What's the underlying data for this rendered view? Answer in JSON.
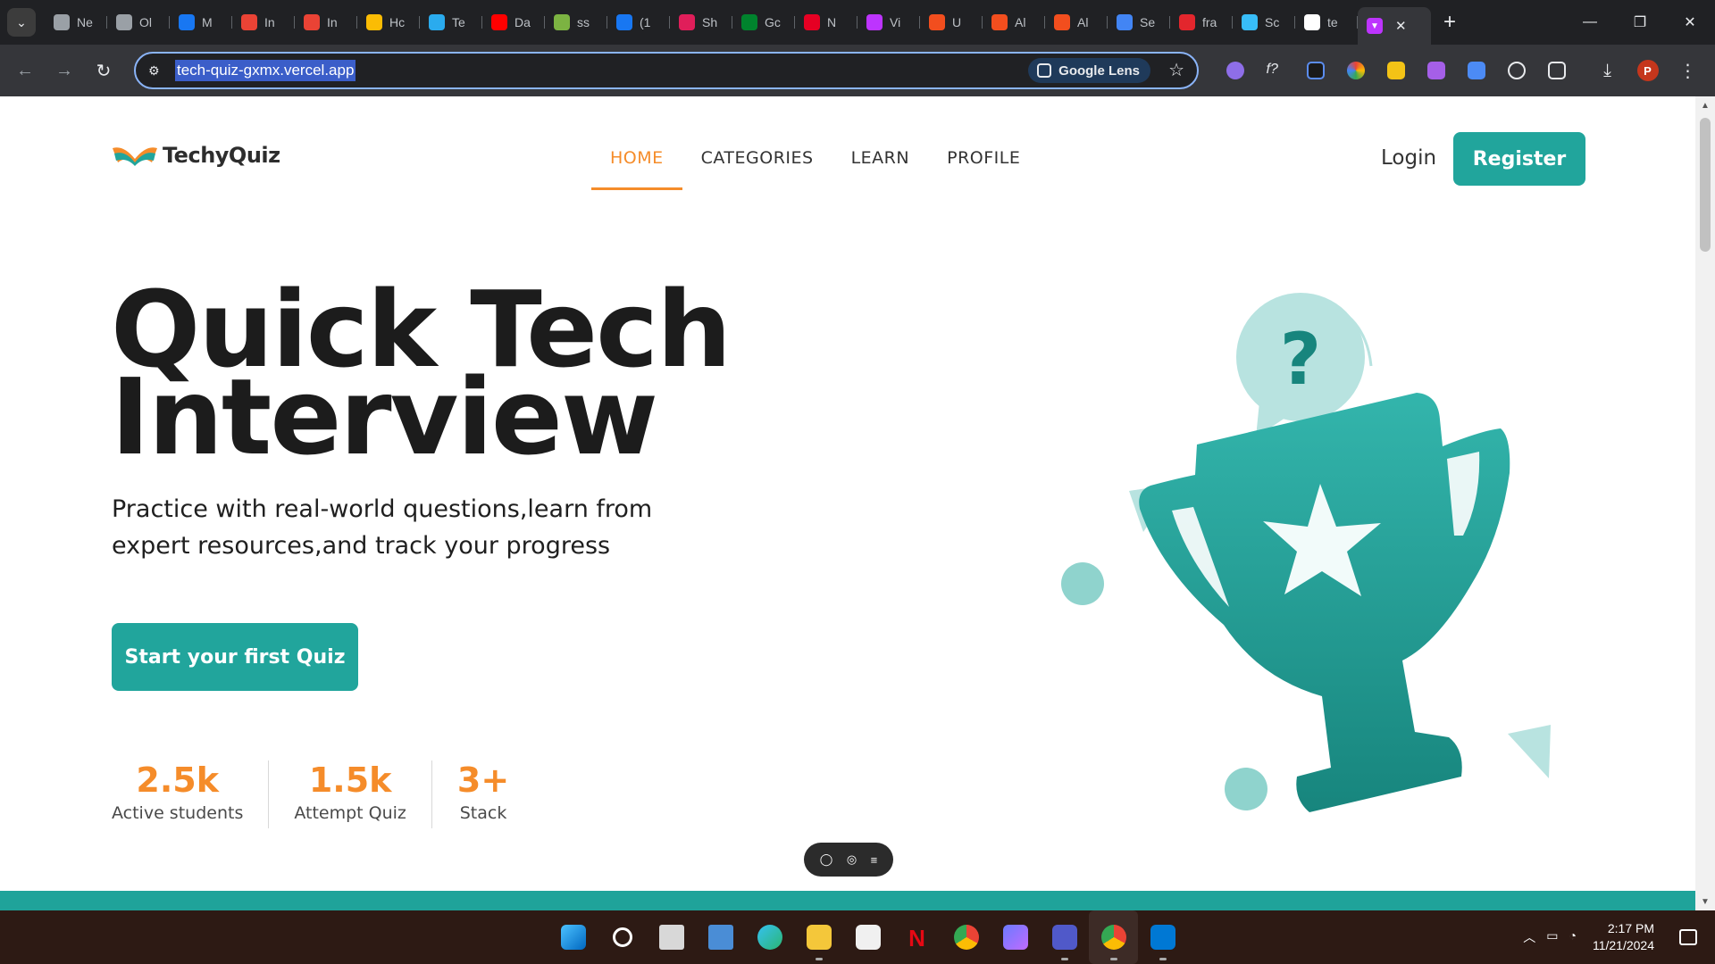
{
  "browser": {
    "tabs": [
      {
        "label": "Ne",
        "icon": "chrome-icon",
        "color": "#9aa0a6"
      },
      {
        "label": "Ol",
        "icon": "openai-icon",
        "color": "#9aa0a6"
      },
      {
        "label": "M",
        "icon": "meta-icon",
        "color": "#1877f2"
      },
      {
        "label": "In",
        "icon": "gmail-icon",
        "color": "#ea4335"
      },
      {
        "label": "In",
        "icon": "gmail-icon",
        "color": "#ea4335"
      },
      {
        "label": "Hc",
        "icon": "drive-icon",
        "color": "#fbbc04"
      },
      {
        "label": "Te",
        "icon": "telegram-icon",
        "color": "#2aabee"
      },
      {
        "label": "Da",
        "icon": "youtube-icon",
        "color": "#ff0000"
      },
      {
        "label": "ss",
        "icon": "download-icon",
        "color": "#7cb342"
      },
      {
        "label": "(1",
        "icon": "facebook-icon",
        "color": "#1877f2"
      },
      {
        "label": "Sh",
        "icon": "slack-icon",
        "color": "#e01e5a"
      },
      {
        "label": "Gc",
        "icon": "meet-icon",
        "color": "#00832d"
      },
      {
        "label": "N",
        "icon": "pinterest-icon",
        "color": "#e60023"
      },
      {
        "label": "Vi",
        "icon": "vite-icon",
        "color": "#bd34fe"
      },
      {
        "label": "U",
        "icon": "figma-icon",
        "color": "#f24e1e"
      },
      {
        "label": "Al",
        "icon": "figma-icon",
        "color": "#f24e1e"
      },
      {
        "label": "Al",
        "icon": "figma-icon",
        "color": "#f24e1e"
      },
      {
        "label": "Se",
        "icon": "google-icon",
        "color": "#4285f4"
      },
      {
        "label": "fra",
        "icon": "framer-icon",
        "color": "#e3262d"
      },
      {
        "label": "Sc",
        "icon": "tailwind-icon",
        "color": "#38bdf8"
      },
      {
        "label": "te",
        "icon": "vercel-icon",
        "color": "#ffffff"
      }
    ],
    "active_tab": {
      "label": "",
      "icon": "vite-icon",
      "close": "✕"
    },
    "new_tab": "+",
    "window_controls": {
      "minimize": "—",
      "restore": "❐",
      "close": "✕"
    },
    "url": "tech-quiz-gxmx.vercel.app",
    "lens_label": "Google Lens",
    "star": "☆",
    "profile_initial": "P",
    "menu": "⋮"
  },
  "site": {
    "brand": "TechyQuiz",
    "nav": {
      "home": "HOME",
      "categories": "CATEGORIES",
      "learn": "LEARN",
      "profile": "PROFILE"
    },
    "login": "Login",
    "register": "Register",
    "hero": {
      "title_line1": "Quick Tech",
      "title_line2": "Interview",
      "subtitle": "Practice with real-world questions,learn from expert resources,and track your progress",
      "cta": "Start your first Quiz"
    },
    "stats": [
      {
        "value": "2.5k",
        "label": "Active students"
      },
      {
        "value": "1.5k",
        "label": "Attempt Quiz"
      },
      {
        "value": "3+",
        "label": "Stack"
      }
    ],
    "illustration": {
      "question_mark": "?"
    },
    "colors": {
      "accent": "#f58c2a",
      "brand": "#21a59c"
    }
  },
  "taskbar": {
    "time": "2:17 PM",
    "date": "11/21/2024"
  }
}
